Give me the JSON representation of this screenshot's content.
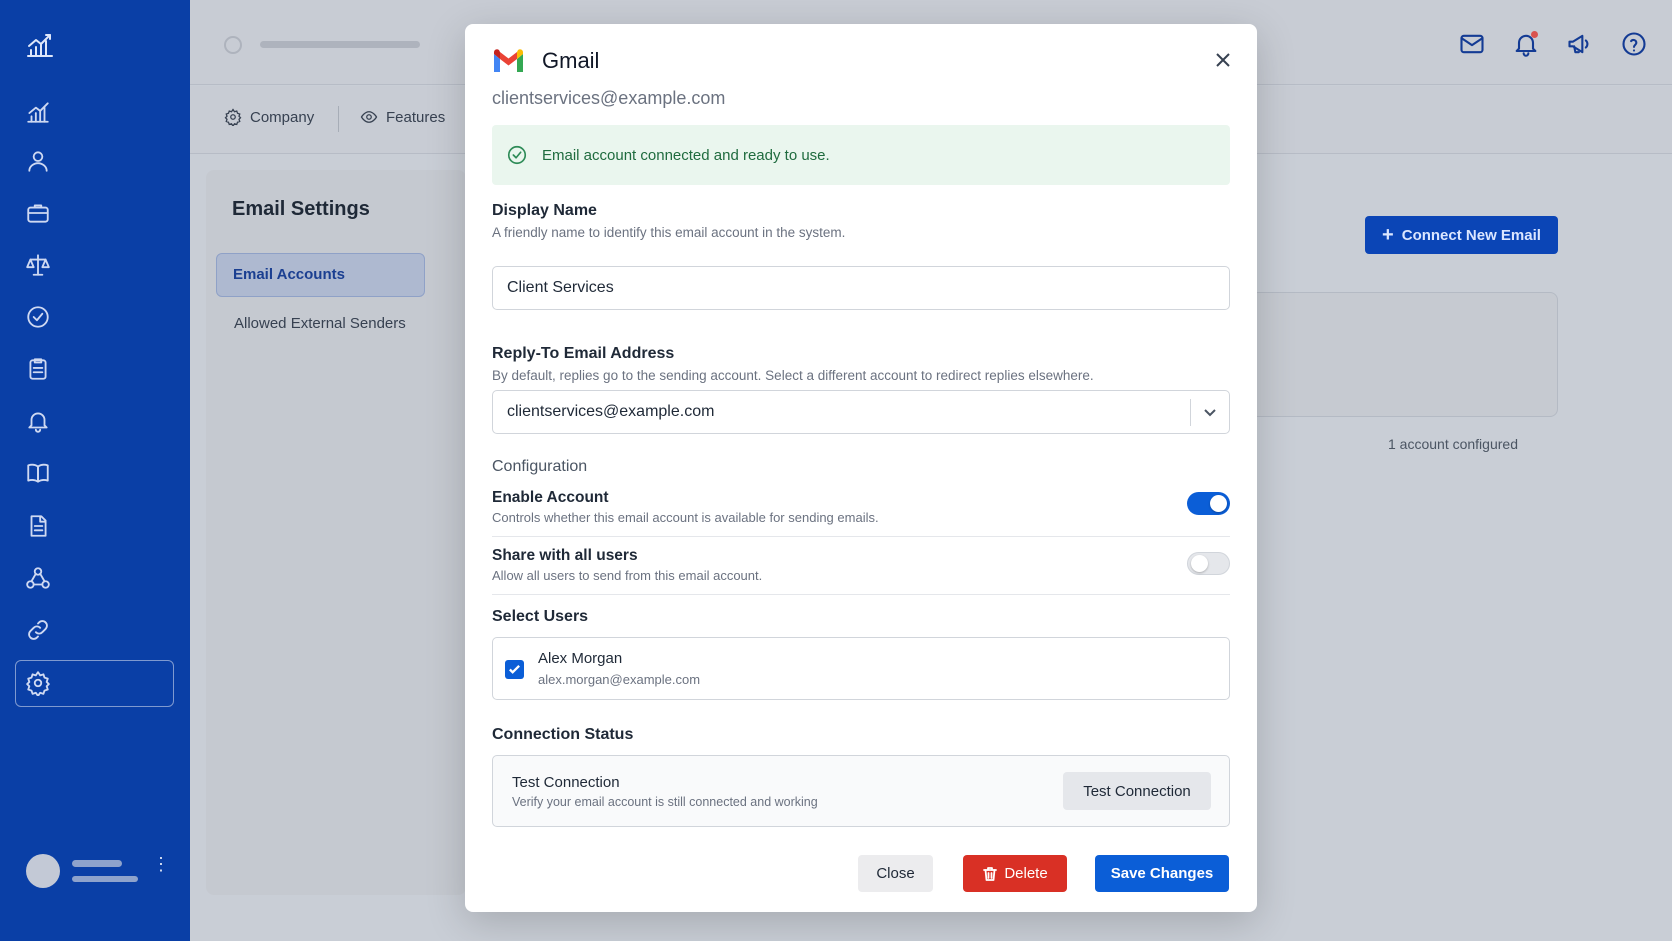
{
  "background": {
    "tabs": [
      {
        "label": "Company",
        "icon": "gear-icon"
      },
      {
        "label": "Features",
        "icon": "eye-icon"
      }
    ],
    "settings": {
      "title": "Email Settings",
      "items": [
        {
          "label": "Email Accounts",
          "active": true
        },
        {
          "label": "Allowed External Senders",
          "active": false
        }
      ]
    },
    "connect_button": "Connect New Email",
    "account_count": "1 account configured"
  },
  "modal": {
    "title": "Gmail",
    "email": "clientservices@example.com",
    "alert": "Email account connected and ready to use.",
    "display_name": {
      "label": "Display Name",
      "help": "A friendly name to identify this email account in the system.",
      "value": "Client Services"
    },
    "reply_to": {
      "label": "Reply-To Email Address",
      "help": "By default, replies go to the sending account. Select a different account to redirect replies elsewhere.",
      "value": "clientservices@example.com"
    },
    "configuration_title": "Configuration",
    "enable_account": {
      "title": "Enable Account",
      "desc": "Controls whether this email account is available for sending emails.",
      "on": true
    },
    "share_all": {
      "title": "Share with all users",
      "desc": "Allow all users to send from this email account.",
      "on": false
    },
    "select_users": {
      "label": "Select Users",
      "users": [
        {
          "name": "Alex Morgan",
          "email": "alex.morgan@example.com",
          "checked": true
        }
      ]
    },
    "connection_status": {
      "label": "Connection Status",
      "title": "Test Connection",
      "desc": "Verify your email account is still connected and working",
      "button": "Test Connection"
    },
    "buttons": {
      "close": "Close",
      "delete": "Delete",
      "save": "Save Changes"
    }
  },
  "colors": {
    "sidebar": "#0a3fa6",
    "primary": "#0b5ed7",
    "danger": "#d93025",
    "success_bg": "#eaf6ee"
  }
}
